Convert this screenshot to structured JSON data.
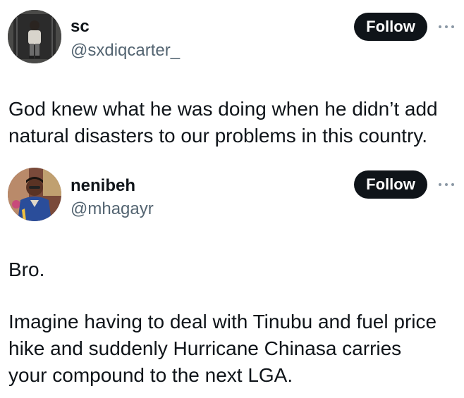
{
  "tweets": [
    {
      "display_name": "sc",
      "handle": "@sxdiqcarter_",
      "follow_label": "Follow",
      "more_icon": "more-icon",
      "text_lines": [
        "God knew what he was doing when he didn’t add",
        "natural disasters to our problems in this country."
      ]
    },
    {
      "display_name": "nenibeh",
      "handle": "@mhagayr",
      "follow_label": "Follow",
      "more_icon": "more-icon",
      "paragraph_1": "Bro.",
      "paragraph_2_lines": [
        "Imagine having to deal with Tinubu and fuel price",
        "hike and suddenly Hurricane Chinasa carries",
        "your compound to the next LGA."
      ]
    }
  ],
  "colors": {
    "text": "#0f1419",
    "secondary": "#536471",
    "button_bg": "#0f1419",
    "button_text": "#ffffff",
    "dots": "#8b98a5"
  }
}
